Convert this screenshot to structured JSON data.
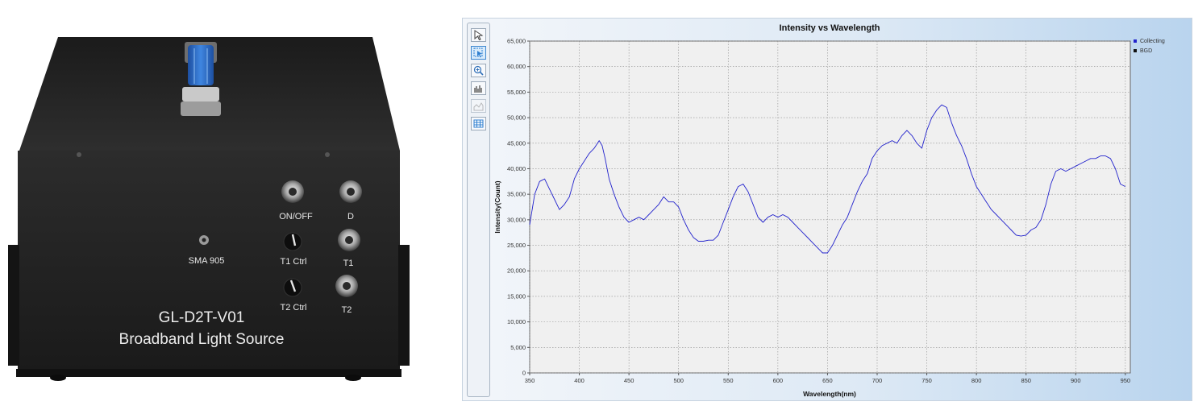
{
  "device": {
    "model": "GL-D2T-V01",
    "name": "Broadband Light Source",
    "labels": {
      "on_off": "ON/OFF",
      "d": "D",
      "sma": "SMA 905",
      "t1_ctrl": "T1 Ctrl",
      "t1": "T1",
      "t2_ctrl": "T2 Ctrl",
      "t2": "T2"
    },
    "handle_color": "#2f6fc4"
  },
  "toolbar": {
    "tools": [
      "pointer-icon",
      "select-icon",
      "zoom-icon",
      "histogram-icon",
      "area-chart-icon",
      "table-icon"
    ],
    "active_tool": "select-icon"
  },
  "chart_data": {
    "type": "line",
    "title": "Intensity vs Wavelength",
    "xlabel": "Wavelength(nm)",
    "ylabel": "Intensity(Count)",
    "xlim": [
      350,
      955
    ],
    "ylim": [
      0,
      65000
    ],
    "x_ticks": [
      350,
      400,
      450,
      500,
      550,
      600,
      650,
      700,
      750,
      800,
      850,
      900,
      950
    ],
    "y_ticks": [
      "0",
      "5,000",
      "10,000",
      "15,000",
      "20,000",
      "25,000",
      "30,000",
      "35,000",
      "40,000",
      "45,000",
      "50,000",
      "55,000",
      "60,000",
      "65,000"
    ],
    "grid": true,
    "legend": [
      "Collecting",
      "BGD"
    ],
    "legend_position": "top-right",
    "series": [
      {
        "name": "Collecting",
        "color": "#2222cc",
        "x": [
          350,
          355,
          360,
          365,
          370,
          375,
          380,
          385,
          390,
          395,
          400,
          405,
          410,
          415,
          420,
          423,
          426,
          430,
          435,
          440,
          445,
          450,
          455,
          460,
          465,
          470,
          475,
          480,
          485,
          490,
          495,
          500,
          505,
          510,
          515,
          520,
          525,
          530,
          535,
          540,
          545,
          550,
          555,
          560,
          565,
          570,
          575,
          580,
          585,
          590,
          595,
          600,
          605,
          610,
          615,
          620,
          625,
          630,
          635,
          640,
          645,
          650,
          655,
          660,
          665,
          670,
          675,
          680,
          685,
          690,
          695,
          700,
          705,
          710,
          715,
          720,
          725,
          730,
          735,
          740,
          745,
          750,
          755,
          760,
          765,
          770,
          775,
          780,
          785,
          790,
          795,
          800,
          805,
          810,
          815,
          820,
          825,
          830,
          835,
          840,
          845,
          850,
          855,
          860,
          865,
          870,
          875,
          880,
          885,
          890,
          895,
          900,
          905,
          910,
          915,
          920,
          925,
          930,
          935,
          940,
          945,
          950
        ],
        "values": [
          29000,
          35000,
          37500,
          38000,
          36000,
          34000,
          32000,
          33000,
          34500,
          38000,
          40000,
          41500,
          43000,
          44000,
          45500,
          44500,
          42000,
          38000,
          35000,
          32500,
          30500,
          29500,
          30000,
          30500,
          30000,
          31000,
          32000,
          33000,
          34500,
          33500,
          33500,
          32500,
          30000,
          28000,
          26500,
          25800,
          25800,
          26000,
          26000,
          27000,
          29500,
          32000,
          34500,
          36500,
          37000,
          35500,
          33000,
          30500,
          29500,
          30500,
          31000,
          30500,
          31000,
          30500,
          29500,
          28500,
          27500,
          26500,
          25500,
          24500,
          23500,
          23500,
          25000,
          27000,
          29000,
          30500,
          33000,
          35500,
          37500,
          39000,
          42000,
          43500,
          44500,
          45000,
          45500,
          45000,
          46500,
          47500,
          46500,
          45000,
          44000,
          47500,
          50000,
          51500,
          52500,
          52000,
          49000,
          46500,
          44500,
          42000,
          39000,
          36500,
          35000,
          33500,
          32000,
          31000,
          30000,
          29000,
          28000,
          27000,
          26800,
          27000,
          28000,
          28500,
          30000,
          33000,
          37000,
          39500,
          40000,
          39500,
          40000,
          40500,
          41000,
          41500,
          42000,
          42000,
          42500,
          42500,
          42000,
          40000,
          37000,
          36500
        ]
      },
      {
        "name": "BGD",
        "color": "#111111",
        "x": [],
        "values": []
      }
    ]
  }
}
